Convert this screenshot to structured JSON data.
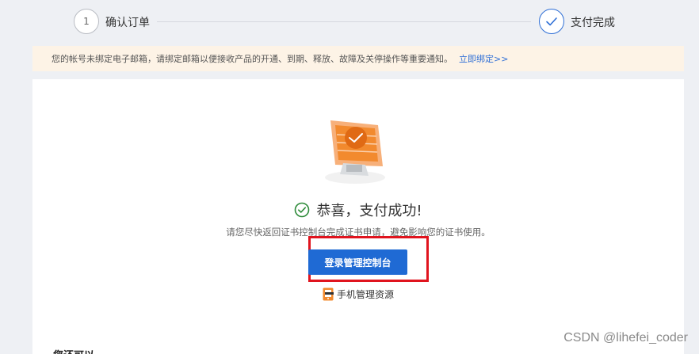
{
  "steps": [
    {
      "number": "1",
      "label": "确认订单"
    },
    {
      "label": "支付完成"
    }
  ],
  "notice": {
    "text": "您的帐号未绑定电子邮箱，请绑定邮箱以便接收产品的开通、到期、释放、故障及关停操作等重要通知。",
    "link": "立即绑定>>"
  },
  "result": {
    "title": "恭喜，支付成功!",
    "subtitle": "请您尽快返回证书控制台完成证书申请，避免影响您的证书使用。",
    "login_button": "登录管理控制台",
    "mobile_link": "手机管理资源",
    "more_heading": "您还可以"
  },
  "watermark": "CSDN @lihefei_coder",
  "colors": {
    "accent": "#1f6ad4",
    "highlight": "#e0141e",
    "success": "#2e8b3a",
    "notice_bg": "#fdf3e6",
    "illustration": "#f28a2e"
  }
}
